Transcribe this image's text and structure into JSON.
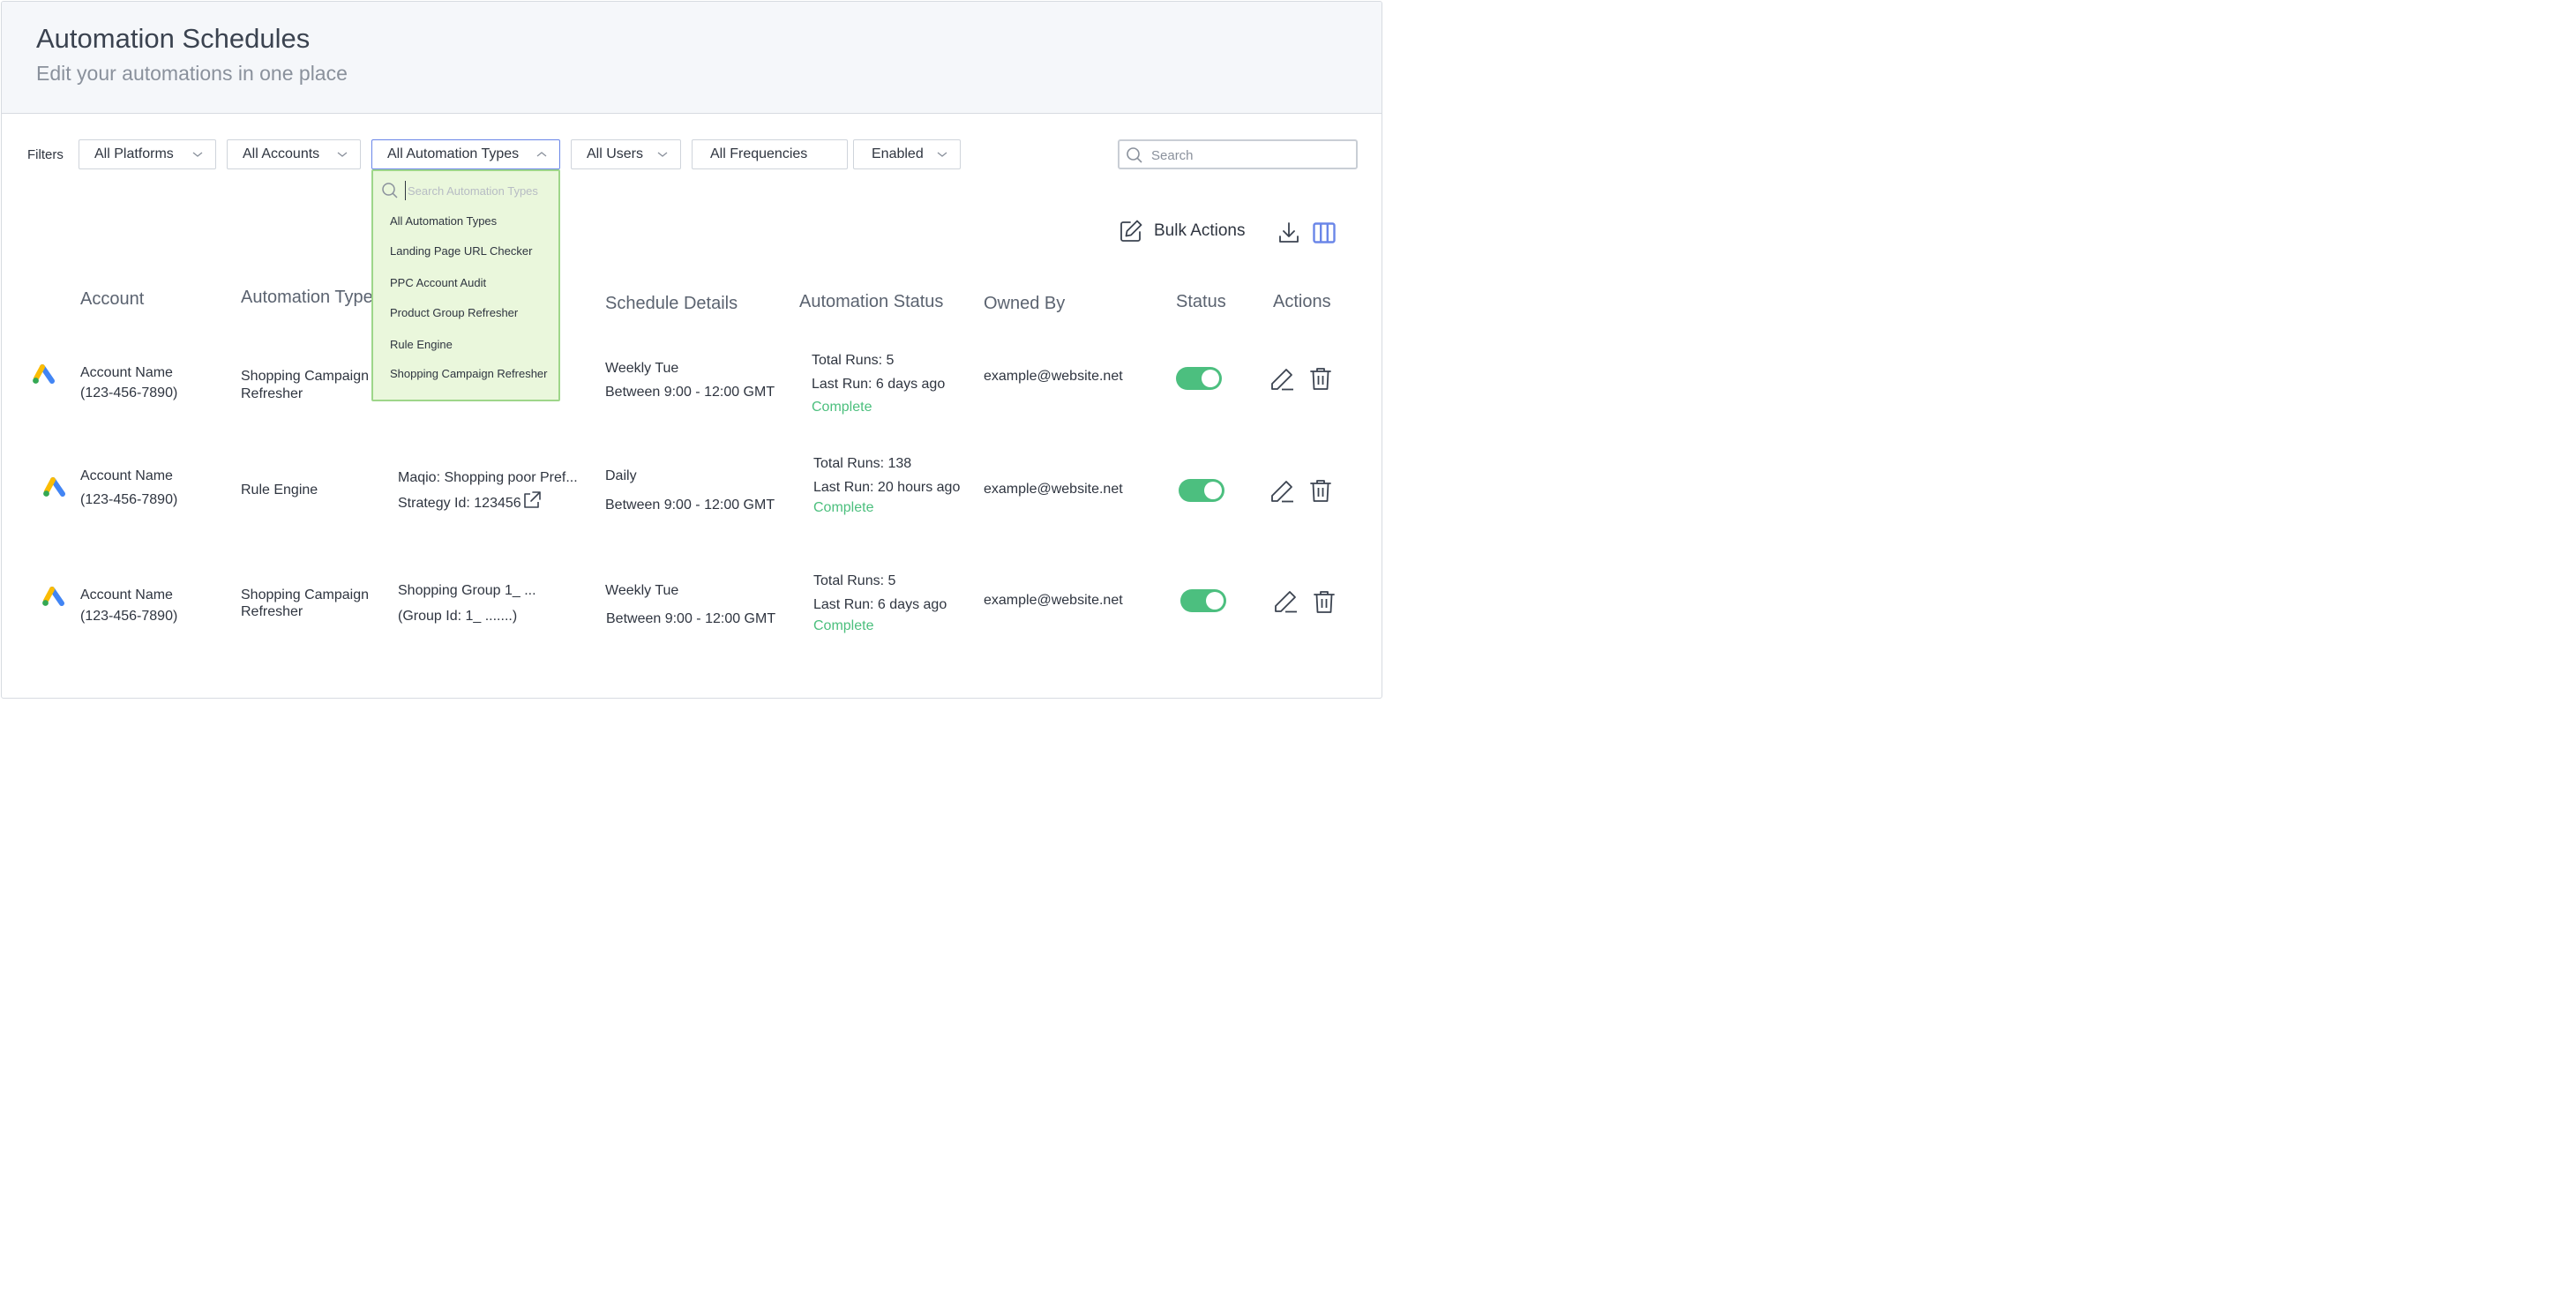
{
  "header": {
    "title": "Automation Schedules",
    "subtitle": "Edit your automations in one place"
  },
  "filters": {
    "label": "Filters",
    "platforms": "All Platforms",
    "accounts": "All Accounts",
    "automation_types": "All Automation Types",
    "users": "All Users",
    "frequencies": "All Frequencies",
    "status": "Enabled",
    "search_placeholder": "Search"
  },
  "dropdown": {
    "search_placeholder": "Search Automation Types",
    "items": [
      "All Automation Types",
      "Landing Page URL Checker",
      "PPC Account Audit",
      "Product Group Refresher",
      "Rule Engine",
      "Shopping Campaign Refresher"
    ]
  },
  "toolbar": {
    "bulk_actions": "Bulk Actions"
  },
  "table": {
    "columns": [
      "Account",
      "Automation Type",
      "Schedule Details",
      "Automation Status",
      "Owned By",
      "Status",
      "Actions"
    ],
    "rows": [
      {
        "account_name": "Account Name",
        "account_id": "(123-456-7890)",
        "type_line1": "Shopping Campaign",
        "type_line2": "Refresher",
        "detail_line1": "",
        "detail_line2": "",
        "schedule_line1": "Weekly Tue",
        "schedule_line2": "Between 9:00 - 12:00 GMT",
        "total_runs": "Total Runs: 5",
        "last_run": "Last Run: 6 days ago",
        "run_status": "Complete",
        "owner": "example@website.net",
        "enabled": true
      },
      {
        "account_name": "Account Name",
        "account_id": "(123-456-7890)",
        "type_line1": "Rule Engine",
        "type_line2": "",
        "detail_line1": "Maqio: Shopping poor Pref...",
        "detail_line2": "Strategy Id: 123456",
        "schedule_line1": "Daily",
        "schedule_line2": "Between 9:00 - 12:00 GMT",
        "total_runs": "Total Runs: 138",
        "last_run": "Last Run: 20 hours ago",
        "run_status": "Complete",
        "owner": "example@website.net",
        "enabled": true
      },
      {
        "account_name": "Account Name",
        "account_id": "(123-456-7890)",
        "type_line1": "Shopping Campaign",
        "type_line2": "Refresher",
        "detail_line1": "Shopping Group 1_ ...",
        "detail_line2": "(Group Id: 1_ .......)",
        "schedule_line1": "Weekly Tue",
        "schedule_line2": "Between 9:00 - 12:00 GMT",
        "total_runs": "Total Runs: 5",
        "last_run": "Last Run: 6 days ago",
        "run_status": "Complete",
        "owner": "example@website.net",
        "enabled": true
      }
    ]
  },
  "colors": {
    "toggle_on": "#4cbf7f",
    "complete": "#4bbf7d",
    "dropdown_bg": "#eaf7dc",
    "dropdown_border": "#9ed68a",
    "accent": "#6a86e8"
  }
}
